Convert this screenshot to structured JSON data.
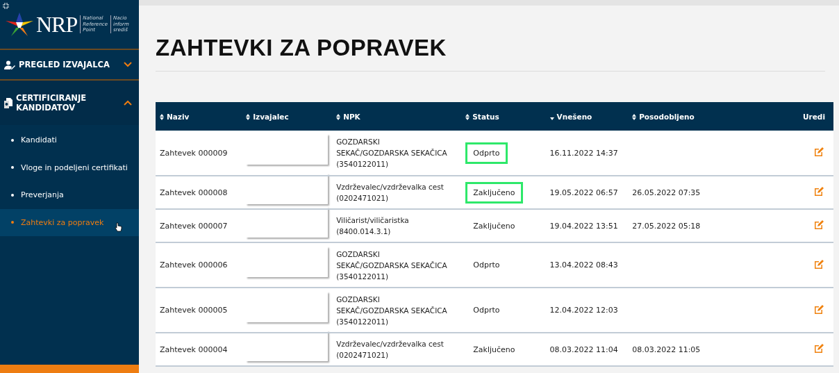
{
  "logo": {
    "mark": "NRP",
    "tagline": "National Reference Point",
    "tagline_2": "Nacio inform središ"
  },
  "sidebar": {
    "sections": [
      {
        "label": "PREGLED IZVAJALCA",
        "kind": "user",
        "expanded": false
      },
      {
        "label": "CERTIFICIRANJE KANDIDATOV",
        "kind": "document",
        "expanded": true
      }
    ],
    "items": [
      {
        "label": "Kandidati",
        "selected": false
      },
      {
        "label": "Vloge in podeljeni certifikati",
        "selected": false
      },
      {
        "label": "Preverjanja",
        "selected": false
      },
      {
        "label": "Zahtevki za popravek",
        "selected": true
      }
    ]
  },
  "page_title": "ZAHTEVKI ZA POPRAVEK",
  "table": {
    "columns": [
      {
        "label": "Naziv",
        "kind": "sortable"
      },
      {
        "label": "Izvajalec",
        "kind": "sortable"
      },
      {
        "label": "NPK",
        "kind": "sortable"
      },
      {
        "label": "Status",
        "kind": "sortable"
      },
      {
        "label": "Vnešeno",
        "kind": "sorted"
      },
      {
        "label": "Posodobljeno",
        "kind": "sortable"
      },
      {
        "label": "Uredi",
        "kind": "plain"
      }
    ],
    "rows": [
      {
        "naziv": "Zahtevek 000009",
        "npk": [
          "GOZDARSKI",
          "SEKAČ/GOZDARSKA SEKAČICA",
          "(3540122011)"
        ],
        "status": "Odprto",
        "highlighted": true,
        "vneseno": "16.11.2022 14:37",
        "posodobljeno": ""
      },
      {
        "naziv": "Zahtevek 000008",
        "npk": [
          "Vzdrževalec/vzdrževalka cest",
          "(0202471021)"
        ],
        "status": "Zaključeno",
        "highlighted": true,
        "vneseno": "19.05.2022 06:57",
        "posodobljeno": "26.05.2022 07:35"
      },
      {
        "naziv": "Zahtevek 000007",
        "npk": [
          "Viličarist/viličaristka",
          "(8400.014.3.1)"
        ],
        "status": "Zaključeno",
        "highlighted": false,
        "vneseno": "19.04.2022 13:51",
        "posodobljeno": "27.05.2022 05:18"
      },
      {
        "naziv": "Zahtevek 000006",
        "npk": [
          "GOZDARSKI",
          "SEKAČ/GOZDARSKA SEKAČICA",
          "(3540122011)"
        ],
        "status": "Odprto",
        "highlighted": false,
        "vneseno": "13.04.2022 08:43",
        "posodobljeno": ""
      },
      {
        "naziv": "Zahtevek 000005",
        "npk": [
          "GOZDARSKI",
          "SEKAČ/GOZDARSKA SEKAČICA",
          "(3540122011)"
        ],
        "status": "Odprto",
        "highlighted": false,
        "vneseno": "12.04.2022 12:03",
        "posodobljeno": ""
      },
      {
        "naziv": "Zahtevek 000004",
        "npk": [
          "Vzdrževalec/vzdrževalka cest",
          "(0202471021)"
        ],
        "status": "Zaključeno",
        "highlighted": false,
        "vneseno": "08.03.2022 11:04",
        "posodobljeno": "08.03.2022 11:05"
      }
    ]
  }
}
